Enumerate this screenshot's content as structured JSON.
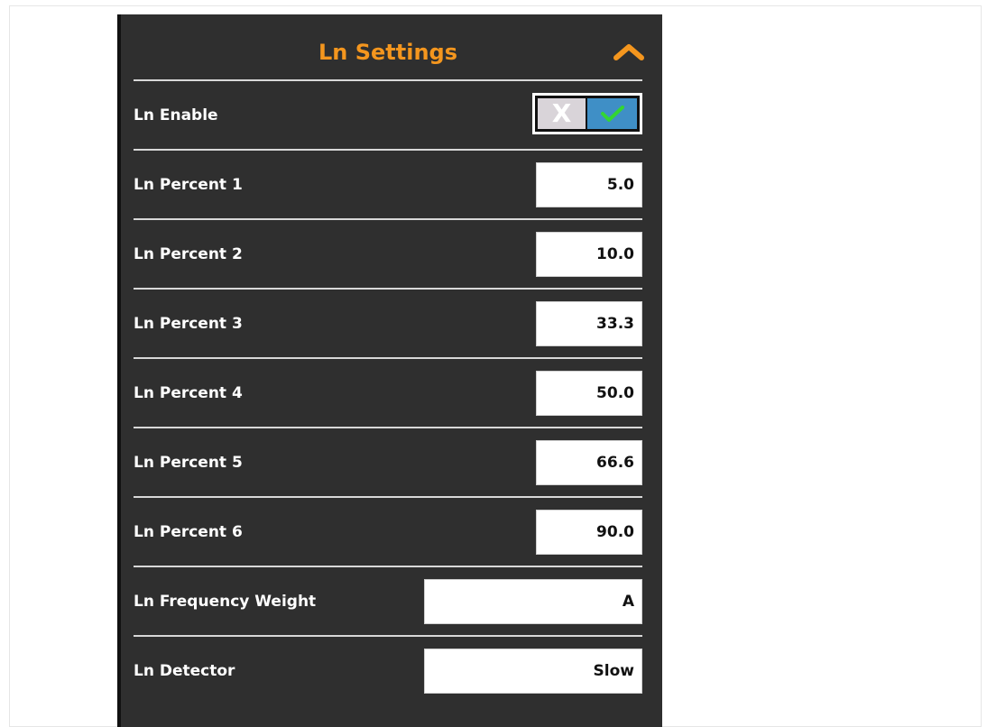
{
  "panel": {
    "title": "Ln Settings",
    "title_color": "#F4961E",
    "collapse_icon": "chevron-up-icon"
  },
  "settings": {
    "enable": {
      "label": "Ln Enable",
      "off_glyph": "X",
      "on_icon": "check-icon",
      "state": "on"
    },
    "percent1": {
      "label": "Ln Percent 1",
      "value": "5.0"
    },
    "percent2": {
      "label": "Ln Percent 2",
      "value": "10.0"
    },
    "percent3": {
      "label": "Ln Percent 3",
      "value": "33.3"
    },
    "percent4": {
      "label": "Ln Percent 4",
      "value": "50.0"
    },
    "percent5": {
      "label": "Ln Percent 5",
      "value": "66.6"
    },
    "percent6": {
      "label": "Ln Percent 6",
      "value": "90.0"
    },
    "frequency_weight": {
      "label": "Ln Frequency Weight",
      "value": "A"
    },
    "detector": {
      "label": "Ln Detector",
      "value": "Slow"
    }
  },
  "colors": {
    "panel_background": "#2F2F2F",
    "toggle_on": "#3F8FC6",
    "check": "#33D633"
  }
}
